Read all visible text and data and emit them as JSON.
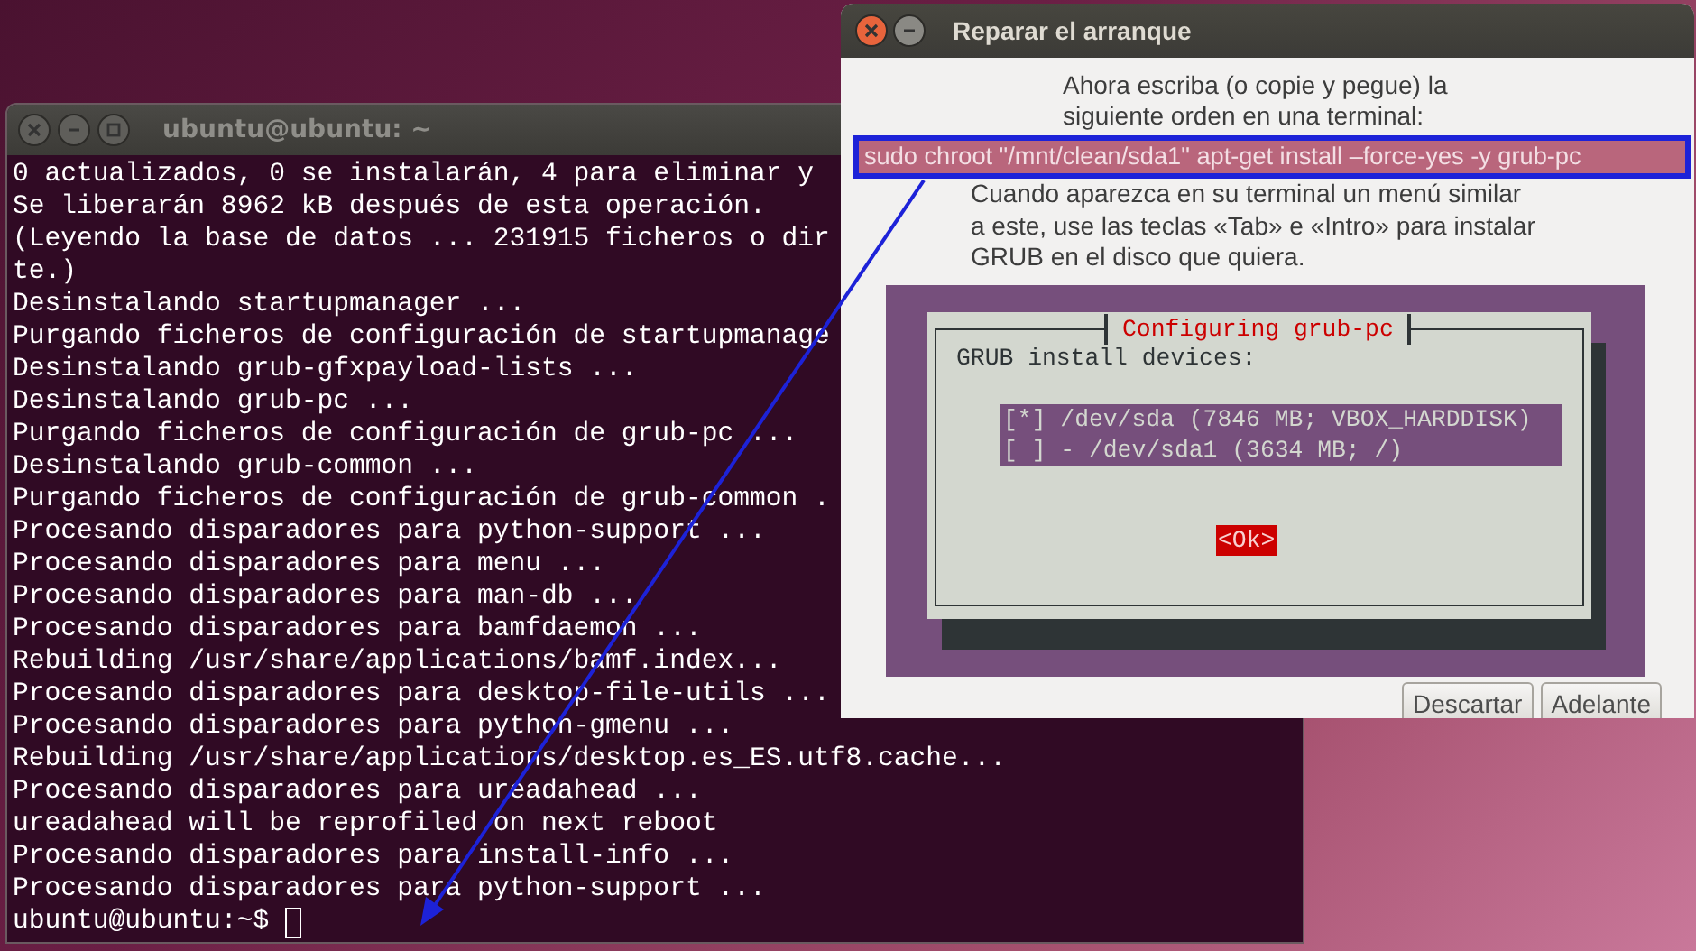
{
  "terminal": {
    "title": "ubuntu@ubuntu: ~",
    "lines": [
      "0 actualizados, 0 se instalarán, 4 para eliminar y",
      "Se liberarán 8962 kB después de esta operación.",
      "(Leyendo la base de datos ... 231915 ficheros o dir",
      "te.)",
      "Desinstalando startupmanager ...",
      "Purgando ficheros de configuración de startupmanage",
      "Desinstalando grub-gfxpayload-lists ...",
      "Desinstalando grub-pc ...",
      "Purgando ficheros de configuración de grub-pc ...",
      "Desinstalando grub-common ...",
      "Purgando ficheros de configuración de grub-common .",
      "Procesando disparadores para python-support ...",
      "Procesando disparadores para menu ...",
      "Procesando disparadores para man-db ...",
      "Procesando disparadores para bamfdaemon ...",
      "Rebuilding /usr/share/applications/bamf.index...",
      "Procesando disparadores para desktop-file-utils ...",
      "Procesando disparadores para python-gmenu ...",
      "Rebuilding /usr/share/applications/desktop.es_ES.utf8.cache...",
      "Procesando disparadores para ureadahead ...",
      "ureadahead will be reprofiled on next reboot",
      "Procesando disparadores para install-info ...",
      "Procesando disparadores para python-support ..."
    ],
    "prompt": "ubuntu@ubuntu:~$"
  },
  "dialog": {
    "title": "Reparar el arranque",
    "intro": [
      "Ahora escriba (o copie y pegue) la",
      "siguiente orden en una terminal:"
    ],
    "command": "sudo chroot \"/mnt/clean/sda1\" apt-get install –force-yes -y grub-pc",
    "instructions": [
      "Cuando aparezca en su terminal un menú similar",
      "a este, use las teclas «Tab» e «Intro» para instalar",
      "GRUB en el disco que quiera."
    ],
    "console": {
      "title": "Configuring grub-pc",
      "prompt": "GRUB install devices:",
      "options": [
        "[*] /dev/sda (7846 MB; VBOX_HARDDISK)",
        "[ ] - /dev/sda1 (3634 MB; /)"
      ],
      "ok": "<Ok>"
    },
    "buttons": [
      "Descartar",
      "Adelante"
    ]
  }
}
